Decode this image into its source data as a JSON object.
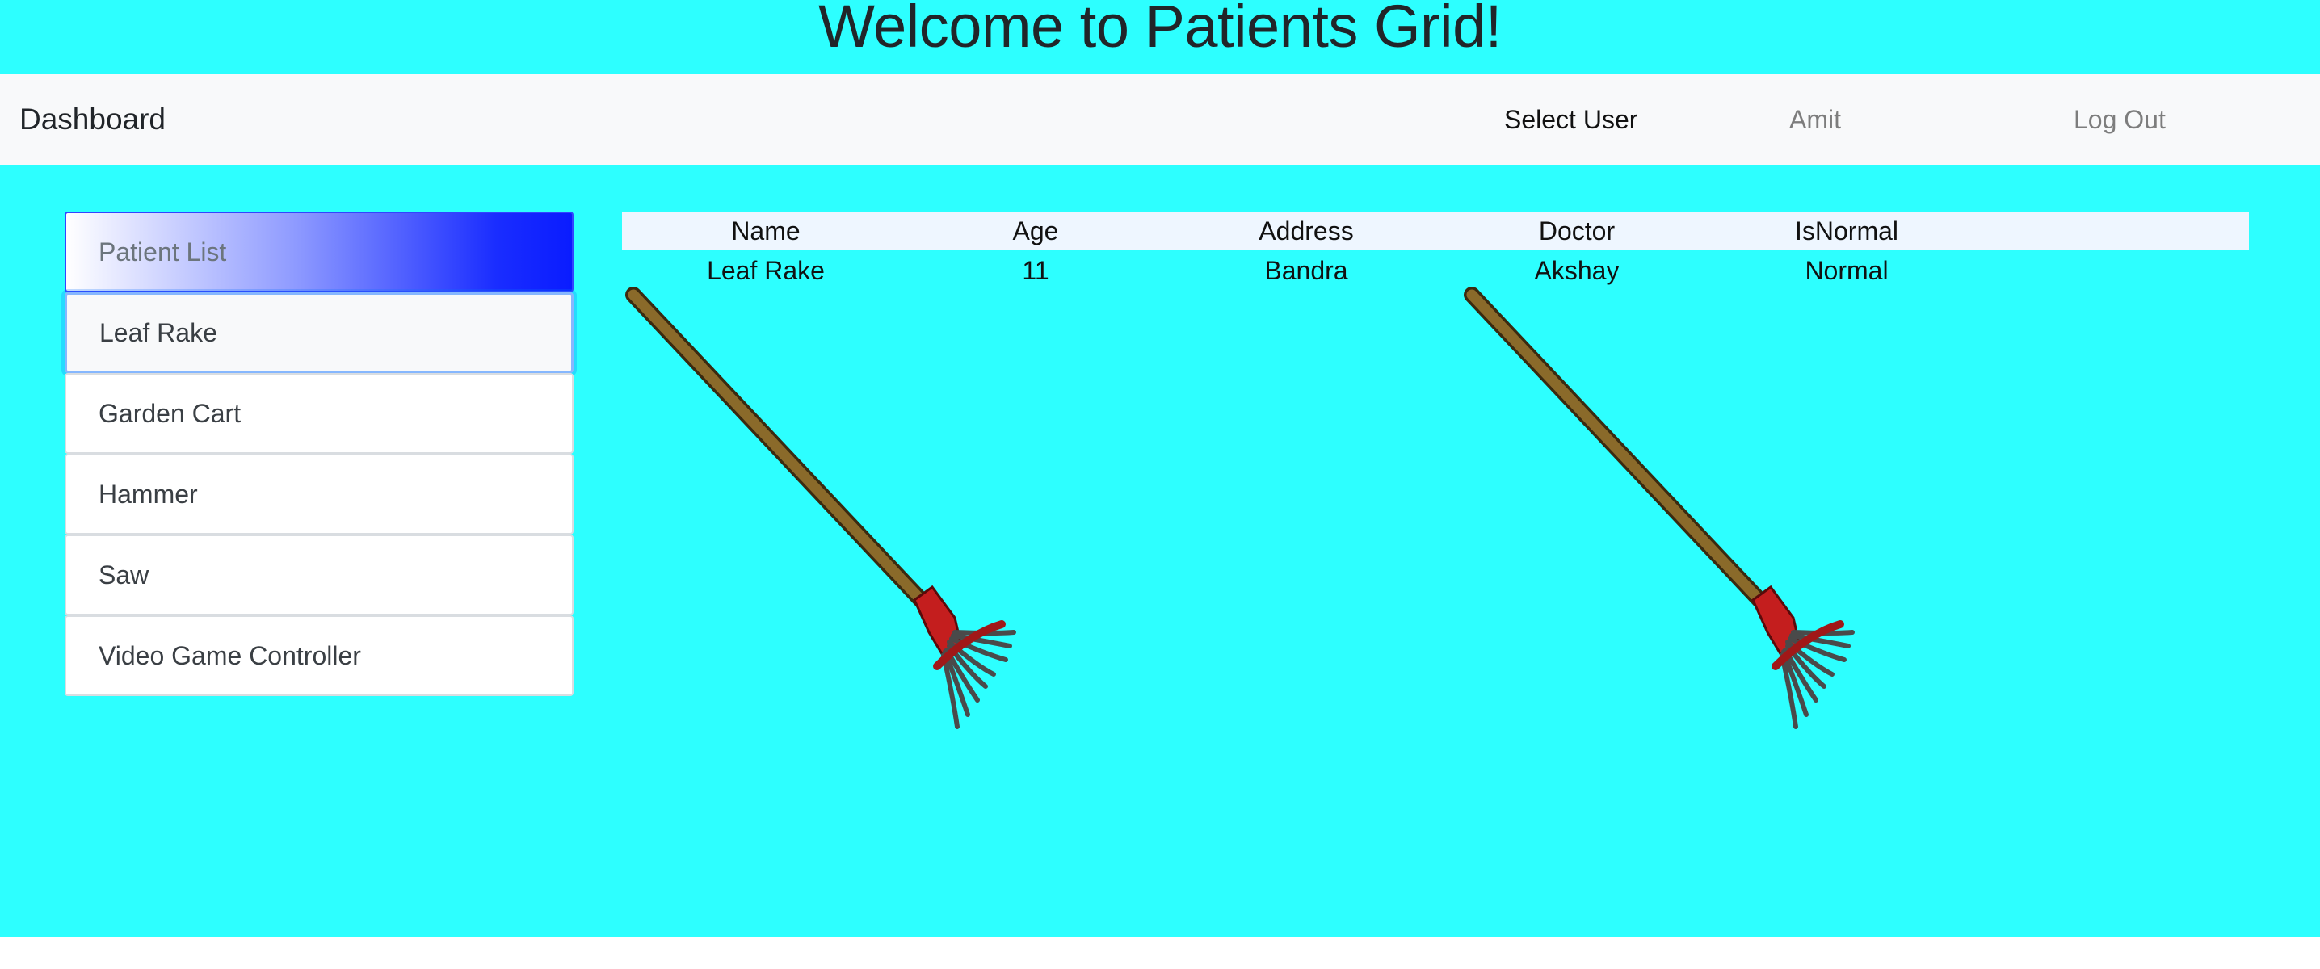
{
  "header": {
    "title": "Welcome to Patients Grid!"
  },
  "navbar": {
    "brand": "Dashboard",
    "select_user": "Select User",
    "user": "Amit",
    "logout": "Log Out"
  },
  "sidebar": {
    "title": "Patient List",
    "items": [
      {
        "label": "Leaf Rake",
        "active": true
      },
      {
        "label": "Garden Cart"
      },
      {
        "label": "Hammer"
      },
      {
        "label": "Saw"
      },
      {
        "label": "Video Game Controller"
      }
    ]
  },
  "grid": {
    "columns": [
      "Name",
      "Age",
      "Address",
      "Doctor",
      "IsNormal"
    ],
    "rows": [
      [
        "Leaf Rake",
        "11",
        "Bandra",
        "Akshay",
        "Normal"
      ]
    ]
  },
  "images": [
    {
      "icon": "leaf-rake-icon"
    },
    {
      "icon": "leaf-rake-icon"
    }
  ],
  "colors": {
    "background": "#2dffff",
    "navbar": "#f8f9fa",
    "list_header_gradient_end": "#0a1cff",
    "grid_header": "#eef6ff",
    "rake_handle": "#8a6a2a",
    "rake_head": "#c41e1e"
  }
}
